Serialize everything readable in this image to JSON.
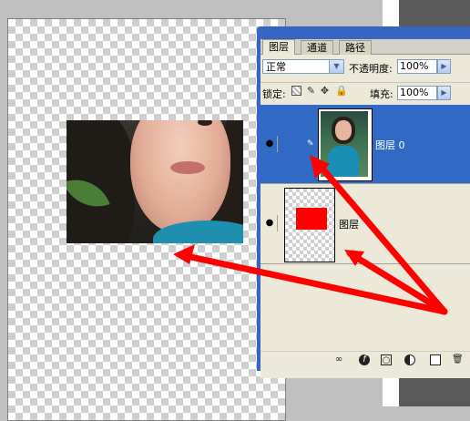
{
  "layers_panel": {
    "tabs": [
      {
        "label": "图层"
      },
      {
        "label": "通道"
      },
      {
        "label": "路径"
      }
    ],
    "blend_mode": "正常",
    "opacity_label": "不透明度:",
    "opacity_value": "100%",
    "lock_label": "锁定:",
    "fill_label": "填充:",
    "fill_value": "100%",
    "layers": [
      {
        "name": "图层 0",
        "selected": true,
        "visible": true
      },
      {
        "name": "图层",
        "selected": false,
        "visible": true
      }
    ],
    "lock_icons": [
      "lock-transparent-icon",
      "lock-image-icon",
      "lock-position-icon",
      "lock-all-icon"
    ],
    "bottom_icons": [
      "link-layers-icon",
      "add-style-icon",
      "add-mask-icon",
      "adjustment-layer-icon",
      "new-layer-icon",
      "delete-layer-icon"
    ]
  },
  "colors": {
    "panel_titlebar": "#3665c4",
    "panel_bg": "#ece9d8",
    "selected_row": "#316ac5",
    "annotation_arrow": "#ff0000",
    "thumbnail_red_shape": "#ff0000"
  }
}
